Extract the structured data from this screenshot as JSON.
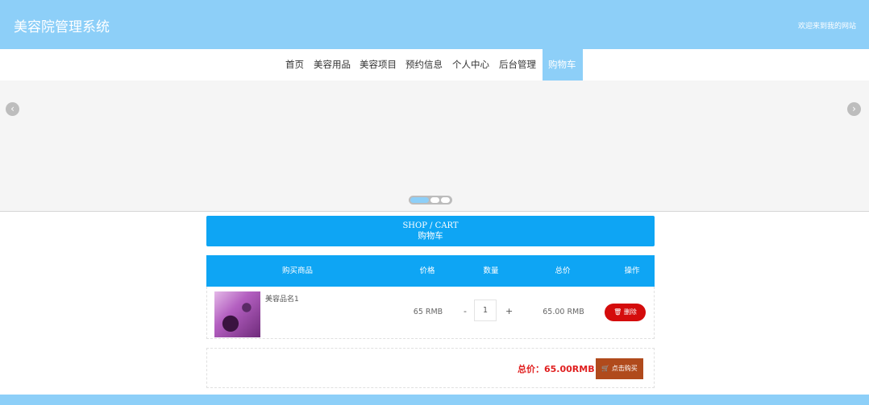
{
  "header": {
    "title": "美容院管理系统",
    "welcome": "欢迎来到我的网站"
  },
  "nav": {
    "items": [
      {
        "label": "首页"
      },
      {
        "label": "美容用品"
      },
      {
        "label": "美容项目"
      },
      {
        "label": "预约信息"
      },
      {
        "label": "个人中心"
      },
      {
        "label": "后台管理"
      },
      {
        "label": "购物车"
      }
    ],
    "active": "购物车"
  },
  "carousel": {
    "prev_icon": "‹",
    "next_icon": "›",
    "slide_count": 3,
    "active_slide": 1
  },
  "cart": {
    "title_en": "SHOP / CART",
    "title_cn": "购物车",
    "columns": [
      "购买商品",
      "价格",
      "数量",
      "总价",
      "操作"
    ],
    "items": [
      {
        "name": "美容品名1",
        "price": "65 RMB",
        "quantity": "1",
        "minus": "-",
        "plus": "+",
        "subtotal": "65.00 RMB",
        "delete_label": "删除"
      }
    ],
    "total_text": "总价：65.00RMB",
    "buy_label": "点击购买"
  },
  "colors": {
    "theme": "#8dcff8",
    "primary": "#0ea5f4",
    "delete": "#d40c0c",
    "buy": "#b04a1c",
    "total": "#e02020"
  }
}
